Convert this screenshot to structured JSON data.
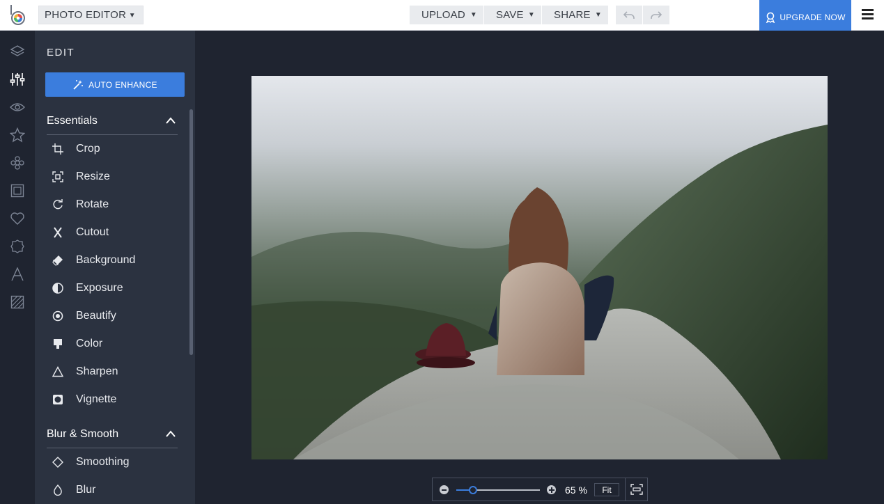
{
  "header": {
    "app_menu_label": "PHOTO EDITOR",
    "upload_label": "UPLOAD",
    "save_label": "SAVE",
    "share_label": "SHARE",
    "upgrade_label": "UPGRADE NOW"
  },
  "rail": {
    "icons": [
      "layers-icon",
      "sliders-icon",
      "eye-icon",
      "star-icon",
      "flower-icon",
      "frame-icon",
      "heart-icon",
      "badge-icon",
      "text-icon",
      "texture-icon"
    ],
    "active": "sliders-icon"
  },
  "panel": {
    "title": "EDIT",
    "auto_enhance_label": "AUTO ENHANCE",
    "sections": [
      {
        "title": "Essentials",
        "tools": [
          {
            "label": "Crop",
            "icon": "crop-icon"
          },
          {
            "label": "Resize",
            "icon": "resize-icon"
          },
          {
            "label": "Rotate",
            "icon": "rotate-icon"
          },
          {
            "label": "Cutout",
            "icon": "scissors-icon"
          },
          {
            "label": "Background",
            "icon": "eraser-icon"
          },
          {
            "label": "Exposure",
            "icon": "exposure-icon"
          },
          {
            "label": "Beautify",
            "icon": "beautify-icon"
          },
          {
            "label": "Color",
            "icon": "color-icon"
          },
          {
            "label": "Sharpen",
            "icon": "triangle-icon"
          },
          {
            "label": "Vignette",
            "icon": "vignette-icon"
          }
        ]
      },
      {
        "title": "Blur & Smooth",
        "tools": [
          {
            "label": "Smoothing",
            "icon": "diamond-icon"
          },
          {
            "label": "Blur",
            "icon": "drop-icon"
          }
        ]
      }
    ]
  },
  "zoom": {
    "level": 0.2,
    "value_label": "65 %",
    "fit_label": "Fit"
  },
  "colors": {
    "accent": "#3b7ddd",
    "panel": "#2b3240",
    "background": "#1f2430"
  }
}
